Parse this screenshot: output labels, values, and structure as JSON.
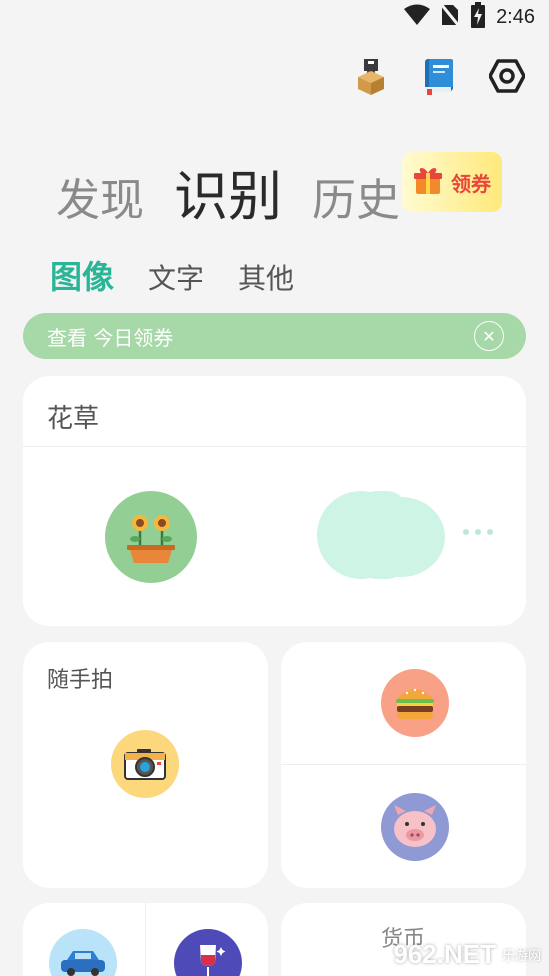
{
  "status_bar": {
    "time": "2:46"
  },
  "top_icons": [
    "package-icon",
    "book-icon",
    "settings-hexagon-icon"
  ],
  "main_tabs": [
    {
      "label": "发现"
    },
    {
      "label": "识别"
    },
    {
      "label": "历史"
    }
  ],
  "coupon_button": {
    "label": "领券"
  },
  "sub_tabs": [
    {
      "label": "图像"
    },
    {
      "label": "文字"
    },
    {
      "label": "其他"
    }
  ],
  "banner": {
    "text": "查看 今日领券"
  },
  "cards": {
    "flower": {
      "title": "花草"
    },
    "random": {
      "title": "随手拍"
    },
    "currency": {
      "title": "货币"
    }
  },
  "watermark": {
    "main": "962.NET",
    "sub": "乐游网"
  },
  "colors": {
    "accent": "#2ab596",
    "banner": "#a6d8a8",
    "coupon_text": "#e8463b"
  }
}
